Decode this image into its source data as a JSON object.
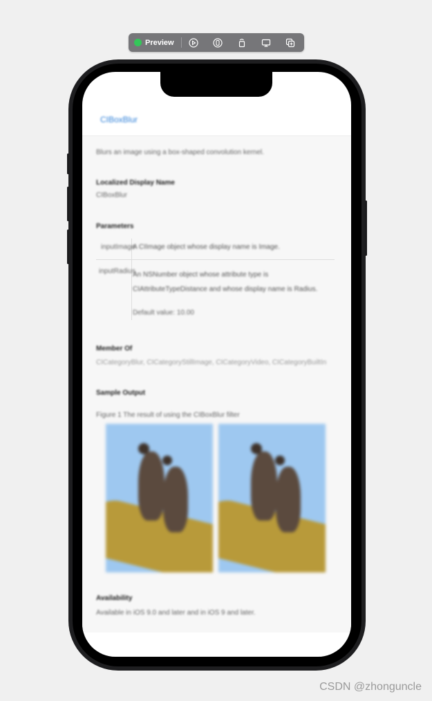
{
  "toolbar": {
    "preview_label": "Preview",
    "icons": [
      "live-preview-icon",
      "variants-icon",
      "rotate-icon",
      "device-settings-icon",
      "duplicate-icon"
    ]
  },
  "doc": {
    "nav_title": "CIBoxBlur",
    "summary": "Blurs an image using a box-shaped convolution kernel.",
    "localized_heading": "Localized Display Name",
    "localized_value": "CIBoxBlur",
    "parameters_heading": "Parameters",
    "params": [
      {
        "name": "inputImage",
        "desc": "A CIImage object whose display name is Image."
      },
      {
        "name": "inputRadius",
        "desc": "An NSNumber object whose attribute type is CIAttributeTypeDistance and whose display name is Radius.",
        "default": "Default value: 10.00"
      }
    ],
    "member_heading": "Member Of",
    "member_value": "CICategoryBlur, CICategoryStillImage, CICategoryVideo, CICategoryBuiltIn",
    "sample_heading": "Sample Output",
    "figure_caption": "Figure 1 The result of using the CIBoxBlur filter",
    "availability_heading": "Availability",
    "availability_value": "Available in iOS 9.0 and later and in iOS 9 and later."
  },
  "watermark": "CSDN @zhonguncle",
  "colors": {
    "accent": "#2f80d8",
    "toolbar": "#767679",
    "status_green": "#34c759"
  }
}
